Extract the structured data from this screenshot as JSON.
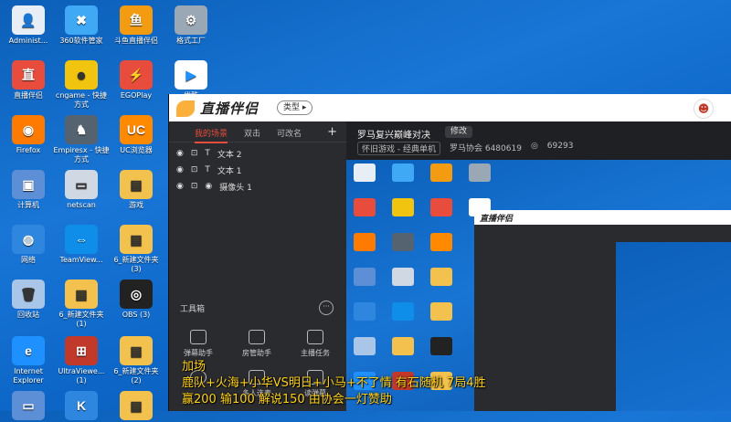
{
  "desktop": {
    "icons": [
      {
        "label": "Administ...",
        "glyph": "👤",
        "color": "#e8eef5",
        "fg": "#333"
      },
      {
        "label": "360软件管家",
        "glyph": "✖",
        "color": "#3fa9f5",
        "fg": "#fff"
      },
      {
        "label": "斗鱼直播伴侣",
        "glyph": "鱼",
        "color": "#f39c12",
        "fg": "#fff"
      },
      {
        "label": "格式工厂",
        "glyph": "⚙",
        "color": "#9aa7b5",
        "fg": "#fff"
      },
      {
        "label": "直播伴侣",
        "glyph": "直",
        "color": "#e74c3c",
        "fg": "#fff"
      },
      {
        "label": "cngame - 快捷方式",
        "glyph": "☻",
        "color": "#f1c40f",
        "fg": "#333"
      },
      {
        "label": "EGOPlay",
        "glyph": "⚡",
        "color": "#e74c3c",
        "fg": "#fff"
      },
      {
        "label": "优酷",
        "glyph": "▶",
        "color": "#ffffff",
        "fg": "#1e90ff"
      },
      {
        "label": "Firefox",
        "glyph": "◉",
        "color": "#ff7a00",
        "fg": "#fff"
      },
      {
        "label": "Empiresx - 快捷方式",
        "glyph": "♞",
        "color": "#556270",
        "fg": "#fff"
      },
      {
        "label": "UC浏览器",
        "glyph": "UC",
        "color": "#ff8a00",
        "fg": "#fff"
      },
      {
        "label": "计算机",
        "glyph": "▣",
        "color": "#5d8fd6",
        "fg": "#fff"
      },
      {
        "label": "netscan",
        "glyph": "▭",
        "color": "#cfd8e3",
        "fg": "#333"
      },
      {
        "label": "游戏",
        "glyph": "▤",
        "color": "#f2c14e",
        "fg": "#333"
      },
      {
        "label": "网络",
        "glyph": "◍",
        "color": "#2e86de",
        "fg": "#fff"
      },
      {
        "label": "TeamView...",
        "glyph": "⇔",
        "color": "#0e8ee9",
        "fg": "#fff"
      },
      {
        "label": "6_新建文件夹 (3)",
        "glyph": "▤",
        "color": "#f2c14e",
        "fg": "#333"
      },
      {
        "label": "回收站",
        "glyph": "🗑",
        "color": "#a9c6e8",
        "fg": "#333"
      },
      {
        "label": "6_新建文件夹 (1)",
        "glyph": "▤",
        "color": "#f2c14e",
        "fg": "#333"
      },
      {
        "label": "OBS (3)",
        "glyph": "◎",
        "color": "#222222",
        "fg": "#fff"
      },
      {
        "label": "Internet Explorer",
        "glyph": "e",
        "color": "#1e90ff",
        "fg": "#fff"
      },
      {
        "label": "UltraViewe... (1)",
        "glyph": "⊞",
        "color": "#c0392b",
        "fg": "#fff"
      },
      {
        "label": "6_新建文件夹 (2)",
        "glyph": "▤",
        "color": "#f2c14e",
        "fg": "#333"
      },
      {
        "label": "",
        "glyph": "▭",
        "color": "#5d8fd6",
        "fg": "#fff"
      },
      {
        "label": "",
        "glyph": "K",
        "color": "#2e86de",
        "fg": "#fff"
      },
      {
        "label": "",
        "glyph": "▤",
        "color": "#f2c14e",
        "fg": "#333"
      }
    ]
  },
  "app": {
    "logo_text": "直播伴侣",
    "type_label": "类型 ▸",
    "tabs": [
      "我的场景",
      "双击",
      "可改名"
    ],
    "add_label": "+",
    "scenes": [
      "文本 2",
      "文本 1",
      "摄像头 1"
    ],
    "eye_icon": "◉",
    "lock_icon": "🔓",
    "toolbox_title": "工具箱",
    "more_label": "···",
    "tools": [
      "弹幕助手",
      "房管助手",
      "主播任务",
      "",
      "多人连麦",
      "读弹幕"
    ],
    "stream_title": "罗马复兴巅峰对决",
    "edit_label": "修改",
    "category": "怀旧游戏 - 经典单机",
    "room_id": "罗马协会 6480619",
    "fans": "69293",
    "nested_logo": "直播伴侣"
  },
  "overlay": {
    "line1": "加场",
    "line2": "鹿队+火海+小华VS明日+小马+不了情 有石随机 7局4胜",
    "line3": "赢200 输100  解说150 由协会一灯赞助"
  }
}
